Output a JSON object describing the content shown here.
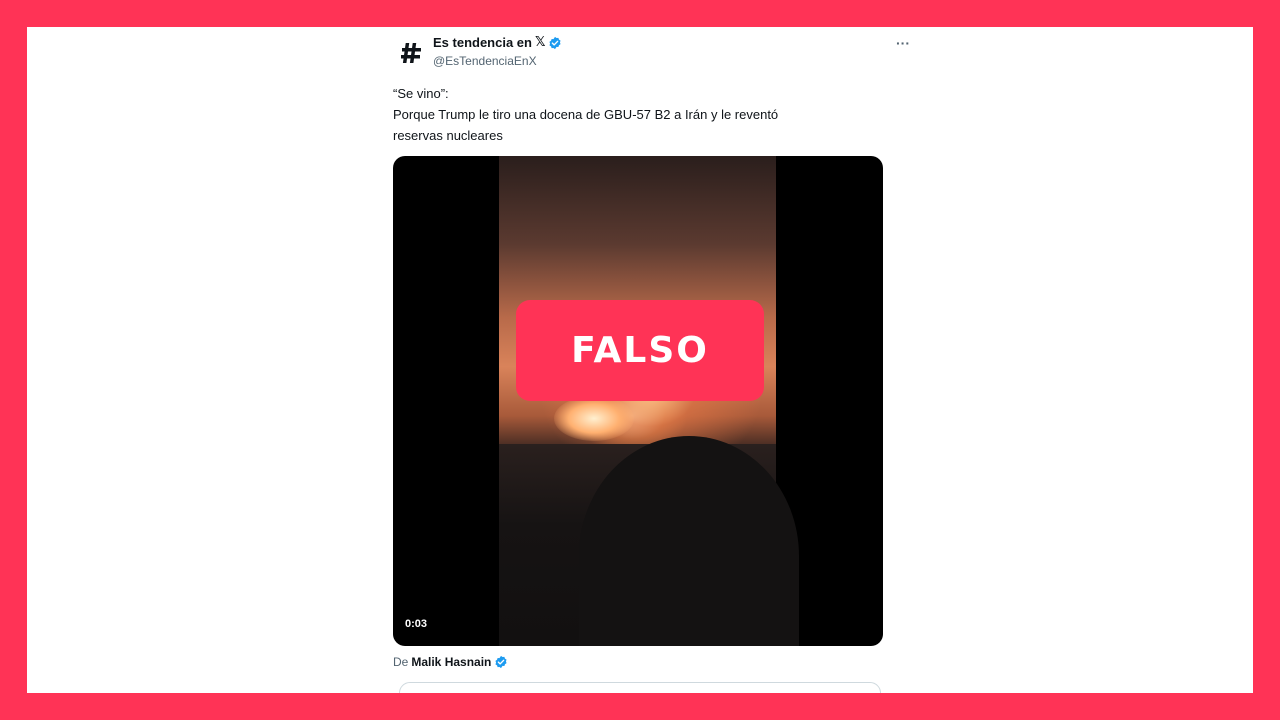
{
  "tweet": {
    "author_name": "Es tendencia en",
    "author_name_mark": "𝕏",
    "avatar_symbol": "#",
    "handle": "@EsTendenciaEnX",
    "more_icon": "···",
    "text_lines": [
      "“Se vino”:",
      "Porque Trump le tiro una docena de GBU-57 B2 a Irán y le reventó",
      "reservas nucleares"
    ],
    "video": {
      "stamp_label": "FALSO",
      "duration": "0:03"
    },
    "from_prefix": "De",
    "from_name": "Malik Hasnain"
  },
  "colors": {
    "frame": "#ff3356",
    "stamp": "#ff3356",
    "verified": "#1d9bf0"
  },
  "icons": [
    "hashtag-avatar-icon",
    "x-logo-icon",
    "verified-badge-icon",
    "more-options-icon"
  ]
}
